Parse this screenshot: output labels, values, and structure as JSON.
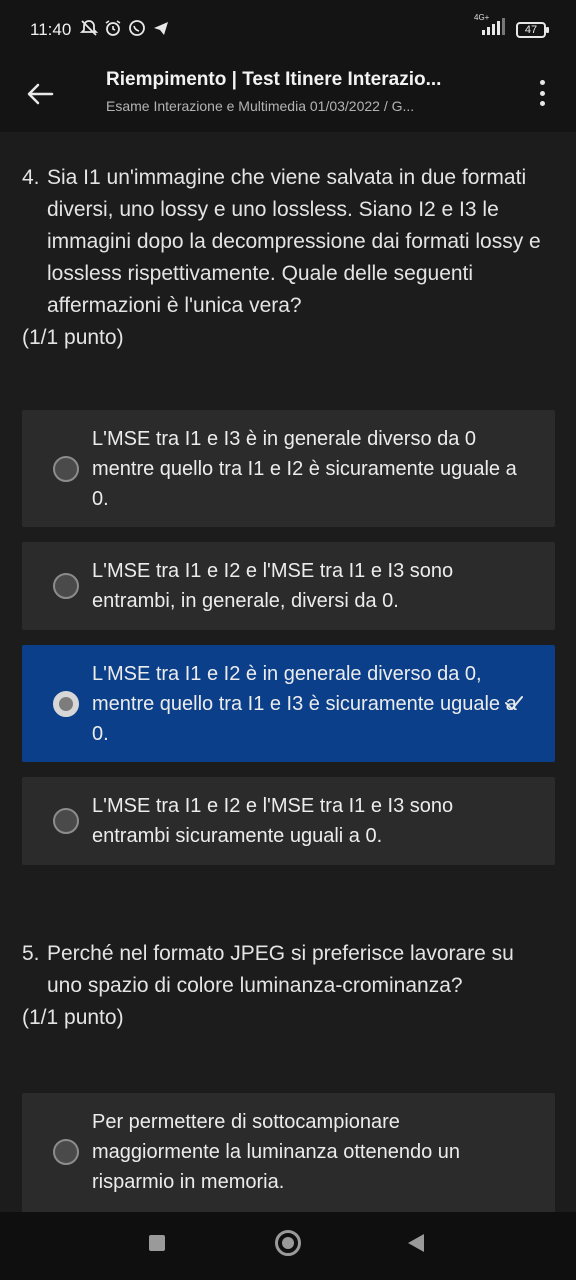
{
  "status_bar": {
    "time": "11:40",
    "network_label": "4G+",
    "battery": "47"
  },
  "app_bar": {
    "title": "Riempimento | Test Itinere Interazio...",
    "subtitle": "Esame Interazione e Multimedia 01/03/2022 / G..."
  },
  "questions": [
    {
      "number": "4.",
      "text": "Sia I1 un'immagine che viene salvata in due formati diversi, uno lossy e uno lossless. Siano I2 e I3 le immagini dopo la decompressione dai formati lossy e lossless rispettivamente. Quale delle seguenti affermazioni è l'unica vera?",
      "points": "(1/1 punto)",
      "options": [
        {
          "label": "L'MSE tra I1 e I3 è in generale diverso da 0 mentre quello tra I1 e I2 è sicuramente uguale a 0.",
          "selected": false
        },
        {
          "label": "L'MSE tra I1 e I2 e l'MSE tra I1 e I3 sono entrambi, in generale, diversi da 0.",
          "selected": false
        },
        {
          "label": "L'MSE tra I1 e I2 è in generale diverso da 0, mentre quello tra I1 e I3 è sicuramente uguale a 0.",
          "selected": true
        },
        {
          "label": "L'MSE tra I1 e I2 e l'MSE tra I1 e I3 sono entrambi sicuramente uguali a 0.",
          "selected": false
        }
      ]
    },
    {
      "number": "5.",
      "text": "Perché nel formato JPEG si preferisce lavorare su uno spazio di colore luminanza-crominanza?",
      "points": "(1/1 punto)",
      "options": [
        {
          "label": "Per permettere di sottocampionare maggiormente la luminanza ottenendo un risparmio in memoria.",
          "selected": false
        }
      ]
    }
  ],
  "colors": {
    "background": "#1c1c1c",
    "option_background": "#2b2b2b",
    "selected_option_background": "#0b3f8a",
    "bar_background": "#141414"
  },
  "icons": {
    "back": "arrow-left-icon",
    "menu": "more-vertical-icon",
    "check": "check-icon",
    "nav_recents": "square-icon",
    "nav_home": "circle-icon",
    "nav_back": "triangle-back-icon"
  }
}
